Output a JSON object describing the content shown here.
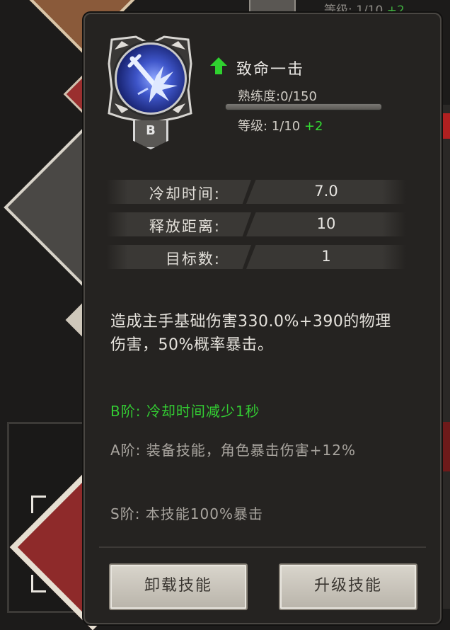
{
  "background": {
    "top_level_text": "等级: 1/10",
    "top_level_plus": "+2"
  },
  "skill": {
    "name": "致命一击",
    "grade": "B",
    "proficiency_label": "熟练度:0/150",
    "proficiency_current": 0,
    "proficiency_max": 150,
    "level_text": "等级: 1/10",
    "level_plus": "+2",
    "icon": "sword-slash-icon",
    "upgrade_indicator_icon": "green-up-arrow-icon",
    "orb_color": "#3e55c9"
  },
  "stats": [
    {
      "label": "冷却时间:",
      "value": "7.0"
    },
    {
      "label": "释放距离:",
      "value": "10"
    },
    {
      "label": "目标数:",
      "value": "1"
    }
  ],
  "description": "造成主手基础伤害330.0%+390的物理伤害，50%概率暴击。",
  "tiers": {
    "b": "B阶: 冷却时间减少1秒",
    "a": "A阶: 装备技能，角色暴击伤害+12%",
    "s": "S阶: 本技能100%暴击"
  },
  "buttons": {
    "unload": "卸载技能",
    "upgrade": "升级技能"
  },
  "colors": {
    "accent_green": "#33cc33",
    "panel_bg": "#252321",
    "button_bg": "#cfcac1"
  }
}
